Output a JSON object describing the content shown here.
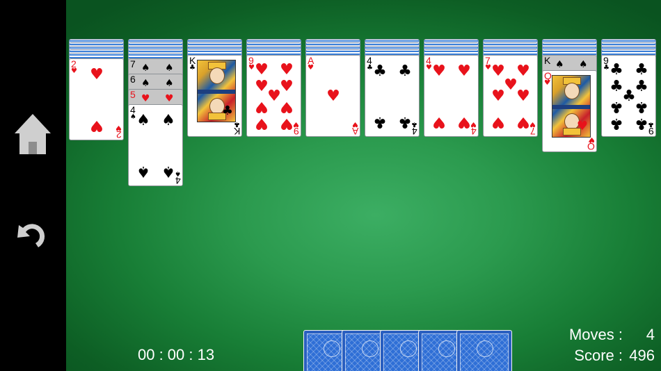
{
  "sidebar": {
    "home_icon": "home-icon",
    "undo_icon": "undo-icon",
    "icon_color": "#cfcfcf"
  },
  "table": {
    "felt_color": "#2b9a4e"
  },
  "tableau": [
    {
      "facedown": 5,
      "cards": [
        {
          "rank": "2",
          "suit": "♥",
          "color": "red"
        }
      ]
    },
    {
      "facedown": 5,
      "cards": [
        {
          "rank": "7",
          "suit": "♠",
          "color": "black",
          "shaded": true
        },
        {
          "rank": "6",
          "suit": "♠",
          "color": "black",
          "shaded": true
        },
        {
          "rank": "5",
          "suit": "♥",
          "color": "red",
          "shaded": true
        },
        {
          "rank": "4",
          "suit": "♠",
          "color": "black"
        }
      ]
    },
    {
      "facedown": 4,
      "cards": [
        {
          "rank": "K",
          "suit": "♣",
          "color": "black",
          "face": true
        }
      ]
    },
    {
      "facedown": 4,
      "cards": [
        {
          "rank": "9",
          "suit": "♥",
          "color": "red"
        }
      ]
    },
    {
      "facedown": 4,
      "cards": [
        {
          "rank": "A",
          "suit": "♥",
          "color": "red"
        }
      ]
    },
    {
      "facedown": 4,
      "cards": [
        {
          "rank": "4",
          "suit": "♣",
          "color": "black"
        }
      ]
    },
    {
      "facedown": 4,
      "cards": [
        {
          "rank": "4",
          "suit": "♥",
          "color": "red"
        }
      ]
    },
    {
      "facedown": 4,
      "cards": [
        {
          "rank": "7",
          "suit": "♥",
          "color": "red"
        }
      ]
    },
    {
      "facedown": 4,
      "cards": [
        {
          "rank": "K",
          "suit": "♠",
          "color": "black",
          "shaded": true
        },
        {
          "rank": "Q",
          "suit": "♥",
          "color": "red",
          "face": true
        }
      ]
    },
    {
      "facedown": 4,
      "cards": [
        {
          "rank": "9",
          "suit": "♣",
          "color": "black"
        }
      ]
    }
  ],
  "timer": {
    "text": "00 : 00 : 13"
  },
  "stock": {
    "piles": 5
  },
  "stats": {
    "moves_label": "Moves :",
    "moves_value": "4",
    "score_label": "Score :",
    "score_value": "496"
  }
}
